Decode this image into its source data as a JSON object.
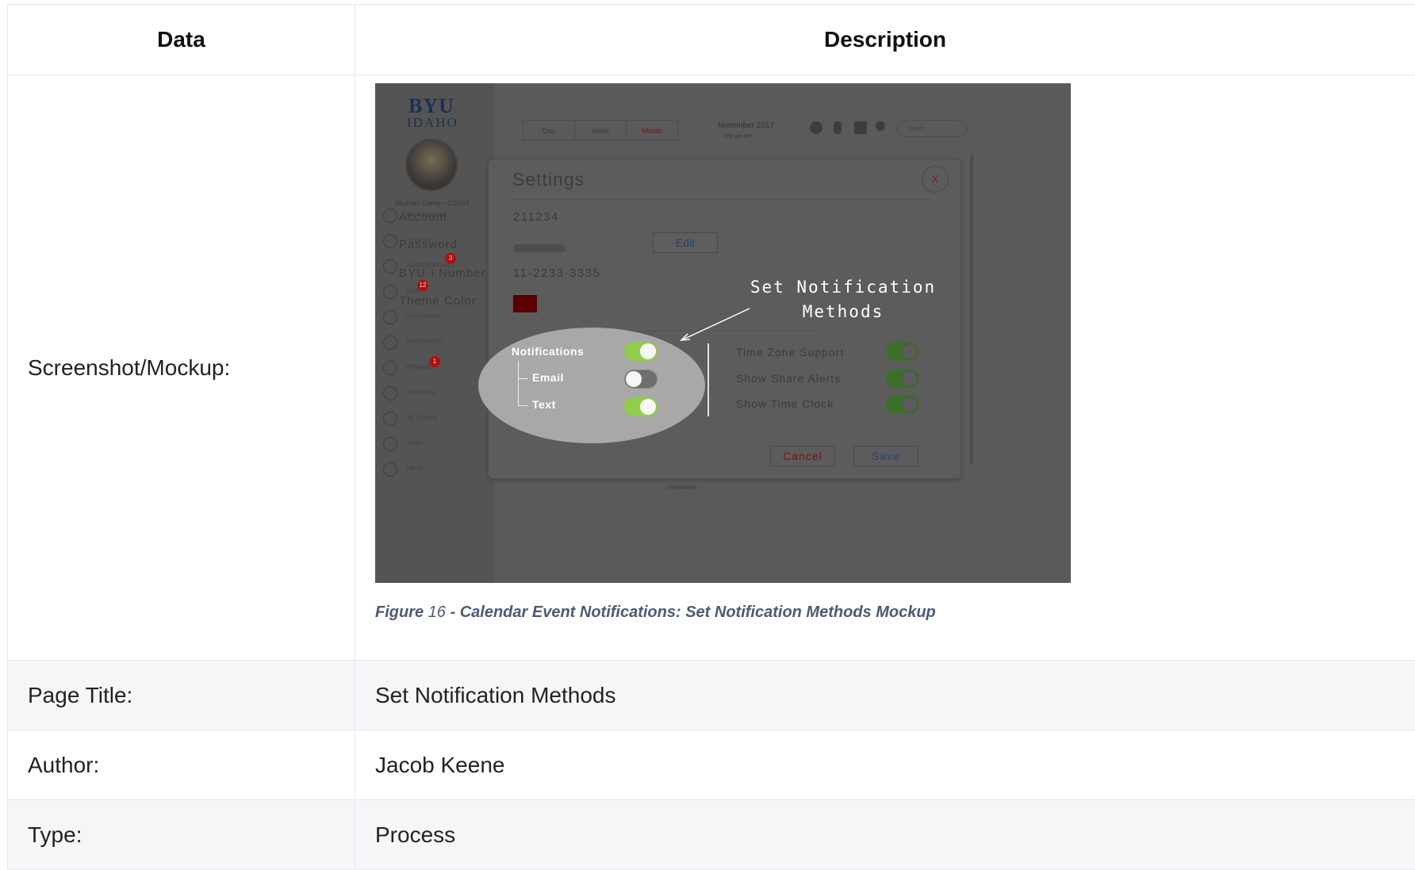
{
  "table": {
    "headers": {
      "data": "Data",
      "description": "Description"
    },
    "rows": [
      {
        "label": "Screenshot/Mockup:"
      },
      {
        "label": "Page Title:",
        "value": "Set Notification Methods"
      },
      {
        "label": "Author:",
        "value": "Jacob Keene"
      },
      {
        "label": "Type:",
        "value": "Process"
      }
    ]
  },
  "caption": {
    "figure_word": "Figure",
    "number": "16",
    "text": "- Calendar Event Notifications: Set Notification Methods Mockup"
  },
  "mockup": {
    "logo_top": "BYU",
    "logo_bottom": "IDAHO",
    "user_name": "Michael Carey - CS364",
    "nav": [
      {
        "label": "MY ACCOUNT",
        "icon": "user-icon"
      },
      {
        "label": "I-LEARN",
        "icon": "home-icon"
      },
      {
        "label": "NOTIFICATIONS",
        "icon": "mail-icon",
        "badge": "3"
      },
      {
        "label": "CHAT",
        "icon": "chat-icon",
        "badge": "12"
      },
      {
        "label": "CALENDAR",
        "icon": "calendar-icon"
      },
      {
        "label": "PROGRESS",
        "icon": "chart-icon"
      },
      {
        "label": "REWARDS",
        "icon": "trophy-icon",
        "badge": "1"
      },
      {
        "label": "TUTORIAL",
        "icon": "play-icon"
      },
      {
        "label": "SETTINGS",
        "icon": "sliders-icon"
      },
      {
        "label": "SYNC",
        "icon": "sync-icon"
      },
      {
        "label": "HELP",
        "icon": "help-icon"
      }
    ],
    "view_tabs": [
      "Day",
      "Week",
      "Month"
    ],
    "month": "November 2017",
    "time": "7:00 pm MT",
    "search_placeholder": "Search",
    "dialog": {
      "title": "Settings",
      "close": "X",
      "account_label": "Account",
      "account_value": "211234",
      "password_label": "Password",
      "edit": "Edit",
      "byui_label": "BYU-I Number",
      "byui_value": "11-2233-3335",
      "theme_label": "Theme Color",
      "theme_color": "#5a0000",
      "notifications_label": "Notifications",
      "email_label": "Email",
      "text_label": "Text",
      "right_options": [
        "Time Zone Support",
        "Show Share Alerts",
        "Show Time Clock"
      ],
      "cancel": "Cancel",
      "save": "Save"
    },
    "annotation_line1": "Set Notification",
    "annotation_line2": "Methods",
    "calendar_event": "Halloween"
  }
}
